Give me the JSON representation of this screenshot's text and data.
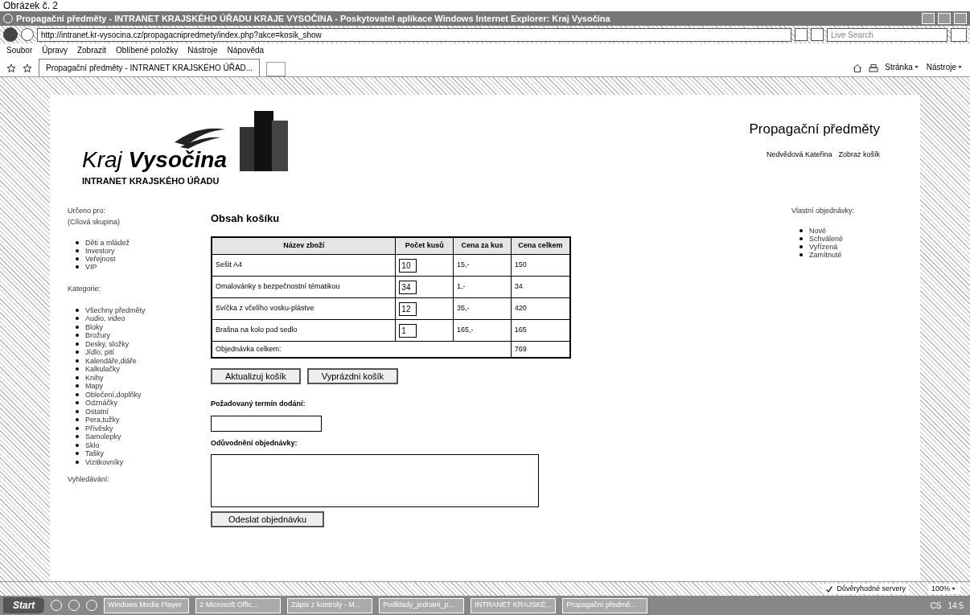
{
  "caption": "Obrázek č. 2",
  "window": {
    "title": "Propagační předměty - INTRANET KRAJSKÉHO ÚŘADU KRAJE VYSOČINA - Poskytovatel aplikace Windows Internet Explorer: Kraj Vysočina"
  },
  "address_bar": {
    "url": "http://intranet.kr-vysocina.cz/propagacnipredmety/index.php?akce=kosik_show",
    "search_placeholder": "Live Search"
  },
  "menu": [
    "Soubor",
    "Úpravy",
    "Zobrazit",
    "Oblíbené položky",
    "Nástroje",
    "Nápověda"
  ],
  "tabs": [
    {
      "label": "Propagační předměty - INTRANET KRAJSKÉHO ÚŘAD...",
      "selected": true
    }
  ],
  "command_bar": [
    "Stránka",
    "Nástroje"
  ],
  "header": {
    "logo_text": "Kraj **Vysočina**",
    "logo_subtitle": "INTRANET KRAJSKÉHO ÚŘADU",
    "app_title": "Propagační předměty",
    "user": "Nedvědová Kateřina",
    "cart_link": "Zobraz košík"
  },
  "sidebar": {
    "target_heading": "Určeno pro:",
    "target_note": "(Cílová skupina)",
    "targets": [
      "Děti a mládež",
      "Investory",
      "Veřejnost",
      "VIP"
    ],
    "categories_heading": "Kategorie:",
    "categories": [
      "Všechny předměty",
      "Audio, video",
      "Bloky",
      "Brožury",
      "Desky, složky",
      "Jídlo, pití",
      "Kalendáře,diáře",
      "Kalkulačky",
      "Knihy",
      "Mapy",
      "Oblečení,doplňky",
      "Odznáčky",
      "Ostatní",
      "Pera,tužky",
      "Přívěsky",
      "Samolepky",
      "Sklo",
      "Tašky",
      "Vizitkovníky"
    ],
    "search_heading": "Vyhledávání:"
  },
  "cart": {
    "title": "Obsah košíku",
    "columns": [
      "Název zboží",
      "Počet kusů",
      "Cena za kus",
      "Cena celkem"
    ],
    "rows": [
      {
        "name": "Sešit A4",
        "quantity": "10",
        "unit_price": "15,-",
        "total": "150"
      },
      {
        "name": "Omalovánky s bezpečnostní tématikou",
        "quantity": "34",
        "unit_price": "1,-",
        "total": "34"
      },
      {
        "name": "Svíčka z včelího vosku-plástve",
        "quantity": "12",
        "unit_price": "35,-",
        "total": "420"
      },
      {
        "name": "Brašna na kolo pod sedlo",
        "quantity": "1",
        "unit_price": "165,-",
        "total": "165"
      }
    ],
    "total_label": "Objednávka celkem:",
    "total_value": "769",
    "buttons": [
      "Aktualizuj košík",
      "Vyprázdni košík"
    ],
    "date_label": "Požadovaný termín dodání:",
    "reason_label": "Odůvodnění objednávky:",
    "submit": "Odeslat objednávku"
  },
  "orders": {
    "heading": "Vlastní objednávky:",
    "items": [
      "Nové",
      "Schválené",
      "Vyřízená",
      "Zamítnuté"
    ]
  },
  "status_bar": {
    "zone": "Důvěryhodné servery",
    "zoom": "100%"
  },
  "taskbar": {
    "start": "Start",
    "items": [
      "Windows Media Player",
      "2 Microsoft Offic...",
      "Zápis z kontroly - M...",
      "Podklady_jednani_p...",
      "INTRANET KRAJSKÉ...",
      "Propagační předmě..."
    ],
    "language": "CS",
    "clock": "14:5"
  }
}
